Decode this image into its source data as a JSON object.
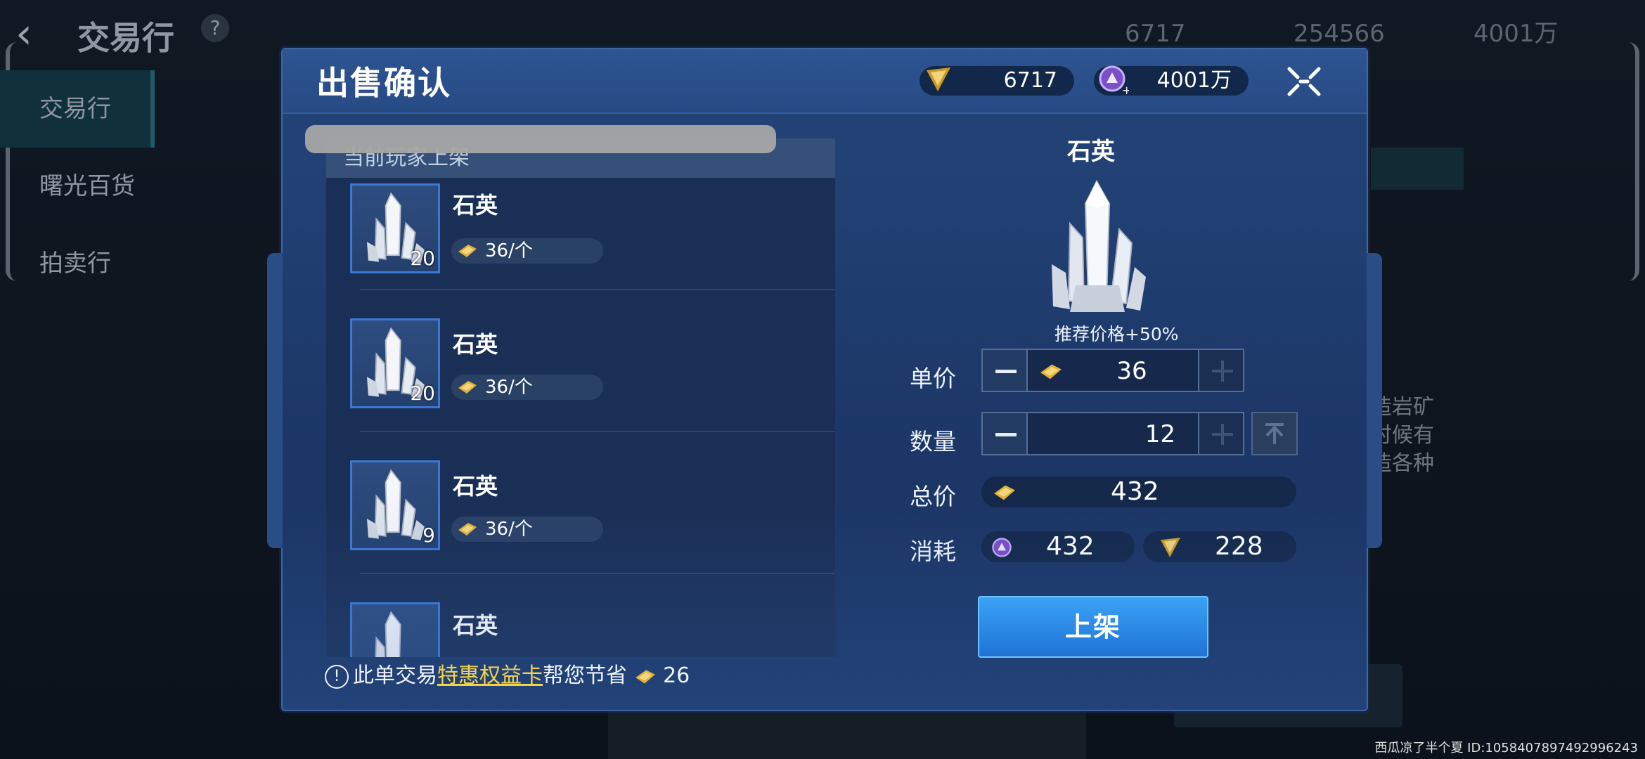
{
  "background": {
    "title": "交易行",
    "help": "?",
    "nav": [
      "交易行",
      "曙光百货",
      "拍卖行"
    ],
    "currencies": [
      "6717",
      "254566",
      "4001万"
    ],
    "right_text": [
      "造岩矿",
      "时候有",
      "造各种"
    ]
  },
  "dialog": {
    "title": "出售确认",
    "currency_a": "6717",
    "currency_b": "4001万",
    "list_header": "当前玩家上架",
    "listings": [
      {
        "name": "石英",
        "count": "20",
        "price": "36/个"
      },
      {
        "name": "石英",
        "count": "20",
        "price": "36/个"
      },
      {
        "name": "石英",
        "count": "9",
        "price": "36/个"
      },
      {
        "name": "石英",
        "count": "",
        "price": ""
      }
    ],
    "detail": {
      "name": "石英",
      "recommend": "推荐价格+50%",
      "unit_price_label": "单价",
      "unit_price": "36",
      "quantity_label": "数量",
      "quantity": "12",
      "total_label": "总价",
      "total": "432",
      "cost_label": "消耗",
      "cost_a": "432",
      "cost_b": "228",
      "sell_button": "上架"
    },
    "footer": {
      "prefix": "此单交易",
      "link": "特惠权益卡",
      "suffix": "帮您节省",
      "saving": "26"
    }
  },
  "watermark": "西瓜凉了半个夏  ID:1058407897492996243"
}
